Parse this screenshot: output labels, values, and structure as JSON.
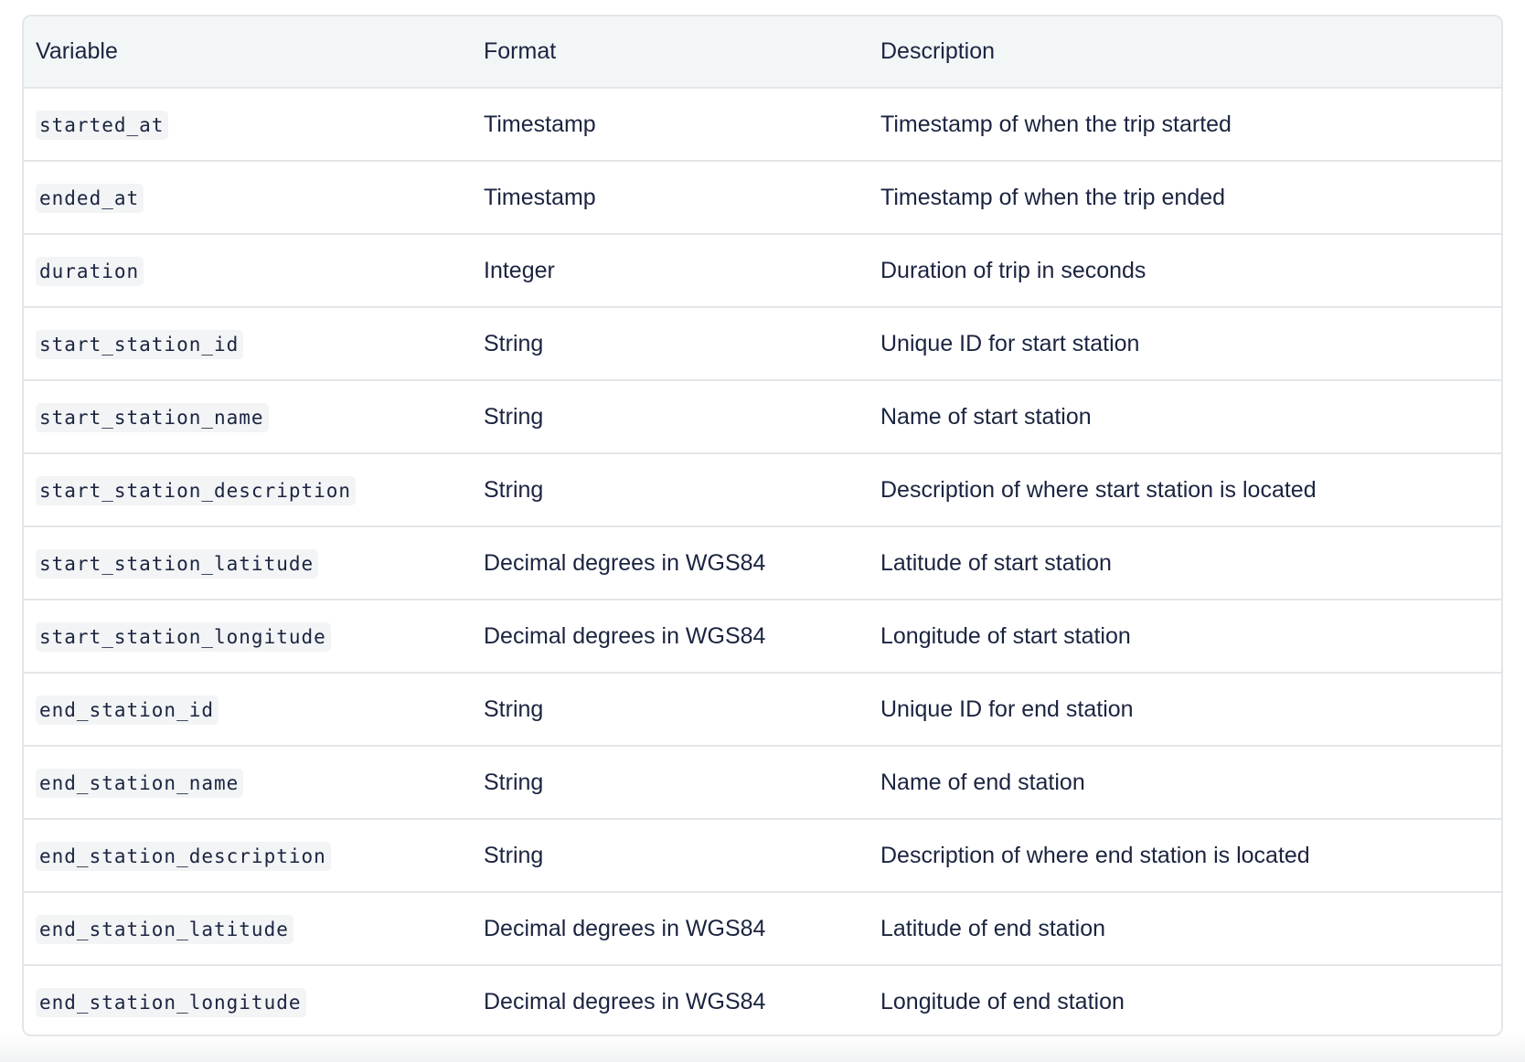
{
  "table": {
    "headers": {
      "variable": "Variable",
      "format": "Format",
      "description": "Description"
    },
    "rows": [
      {
        "variable": "started_at",
        "format": "Timestamp",
        "description": "Timestamp of when the trip started"
      },
      {
        "variable": "ended_at",
        "format": "Timestamp",
        "description": "Timestamp of when the trip ended"
      },
      {
        "variable": "duration",
        "format": "Integer",
        "description": "Duration of trip in seconds"
      },
      {
        "variable": "start_station_id",
        "format": "String",
        "description": "Unique ID for start station"
      },
      {
        "variable": "start_station_name",
        "format": "String",
        "description": "Name of start station"
      },
      {
        "variable": "start_station_description",
        "format": "String",
        "description": "Description of where start station is located"
      },
      {
        "variable": "start_station_latitude",
        "format": "Decimal degrees in WGS84",
        "description": "Latitude of start station"
      },
      {
        "variable": "start_station_longitude",
        "format": "Decimal degrees in WGS84",
        "description": "Longitude of start station"
      },
      {
        "variable": "end_station_id",
        "format": "String",
        "description": "Unique ID for end station"
      },
      {
        "variable": "end_station_name",
        "format": "String",
        "description": "Name of end station"
      },
      {
        "variable": "end_station_description",
        "format": "String",
        "description": "Description of where end station is located"
      },
      {
        "variable": "end_station_latitude",
        "format": "Decimal degrees in WGS84",
        "description": "Latitude of end station"
      },
      {
        "variable": "end_station_longitude",
        "format": "Decimal degrees in WGS84",
        "description": "Longitude of end station"
      }
    ]
  }
}
